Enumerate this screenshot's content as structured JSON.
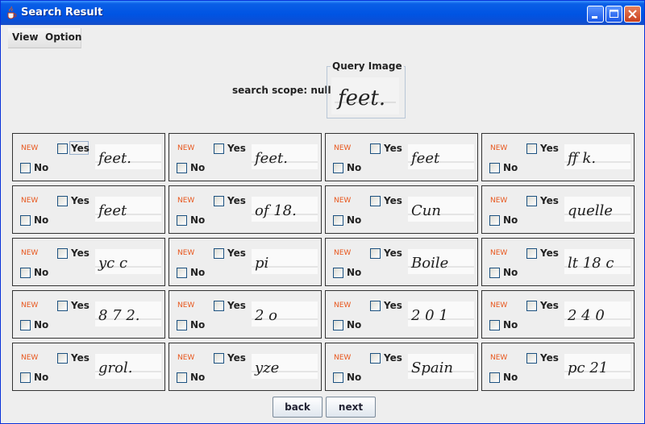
{
  "window": {
    "title": "Search Result"
  },
  "menu": [
    "View",
    "Option"
  ],
  "search": {
    "scope_label": "search scope: null",
    "query_title": "Query Image",
    "query_text": "feet."
  },
  "result_labels": {
    "new": "NEW",
    "yes": "Yes",
    "no": "No"
  },
  "results": [
    {
      "handwriting": "feet."
    },
    {
      "handwriting": "feet."
    },
    {
      "handwriting": "feet"
    },
    {
      "handwriting": "ff k."
    },
    {
      "handwriting": "feet"
    },
    {
      "handwriting": "of 18."
    },
    {
      "handwriting": "Cun"
    },
    {
      "handwriting": "quelle"
    },
    {
      "handwriting": "yc c"
    },
    {
      "handwriting": "pi"
    },
    {
      "handwriting": "Boile"
    },
    {
      "handwriting": "lt 18 c"
    },
    {
      "handwriting": "8 7 2."
    },
    {
      "handwriting": "2 o"
    },
    {
      "handwriting": "2 0 1"
    },
    {
      "handwriting": "2 4 0"
    },
    {
      "handwriting": "grol."
    },
    {
      "handwriting": "yze"
    },
    {
      "handwriting": "Spain"
    },
    {
      "handwriting": "pc 21"
    }
  ],
  "buttons": {
    "back": "back",
    "next": "next"
  },
  "colors": {
    "titlebar": "#0054e3",
    "new_badge": "#e8561c",
    "window_bg": "#eeeeee"
  }
}
